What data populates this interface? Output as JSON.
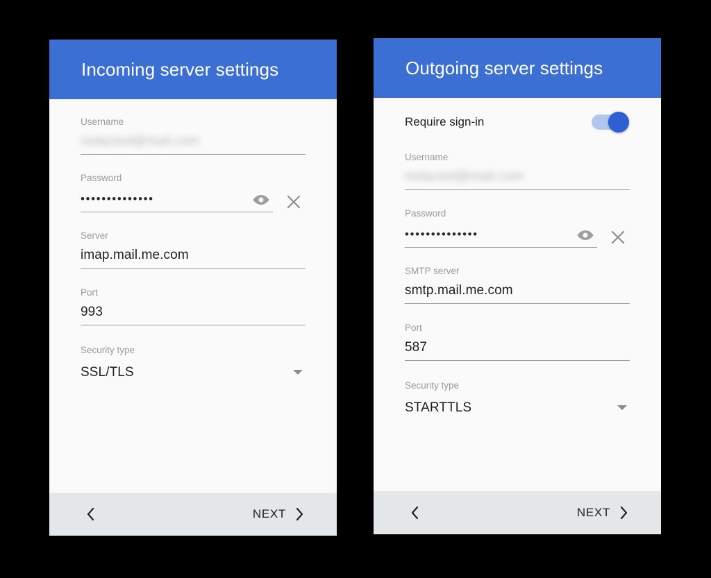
{
  "screens": [
    {
      "id": "incoming",
      "title": "Incoming server settings",
      "accent": "#3b6fd4",
      "fields": [
        {
          "label": "Username",
          "value": "redacted@mail.com",
          "kind": "redacted"
        },
        {
          "label": "Password",
          "value": "••••••••••••••",
          "kind": "password"
        },
        {
          "label": "Server",
          "value": "imap.mail.me.com",
          "kind": "text"
        },
        {
          "label": "Port",
          "value": "993",
          "kind": "text"
        },
        {
          "label": "Security type",
          "value": "SSL/TLS",
          "kind": "dropdown"
        }
      ],
      "footer": {
        "back": "back-chevron",
        "next_label": "NEXT"
      }
    },
    {
      "id": "outgoing",
      "title": "Outgoing server settings",
      "accent": "#3b6fd4",
      "toggle": {
        "label": "Require sign-in",
        "state": "on",
        "track_color": "#b3c6ef",
        "thumb_color": "#2f60d3"
      },
      "fields": [
        {
          "label": "Username",
          "value": "redacted@mail.com",
          "kind": "redacted"
        },
        {
          "label": "Password",
          "value": "••••••••••••••",
          "kind": "password"
        },
        {
          "label": "SMTP server",
          "value": "smtp.mail.me.com",
          "kind": "text"
        },
        {
          "label": "Port",
          "value": "587",
          "kind": "text"
        },
        {
          "label": "Security type",
          "value": "STARTTLS",
          "kind": "dropdown"
        }
      ],
      "footer": {
        "back": "back-chevron",
        "next_label": "NEXT"
      }
    }
  ],
  "icons": {
    "eye": "visibility-eye-icon",
    "clear": "clear-x-icon",
    "caret": "chevron-down-icon",
    "back": "chevron-left-icon",
    "next": "chevron-right-icon"
  },
  "colors": {
    "appbar": "#3b6fd4",
    "card_bg": "#fafafa",
    "footer_bg": "#e3e7ea",
    "underline": "#9c9c9c",
    "label": "#9a9a9a",
    "value": "#1f1f1f",
    "page_bg": "#000000"
  }
}
